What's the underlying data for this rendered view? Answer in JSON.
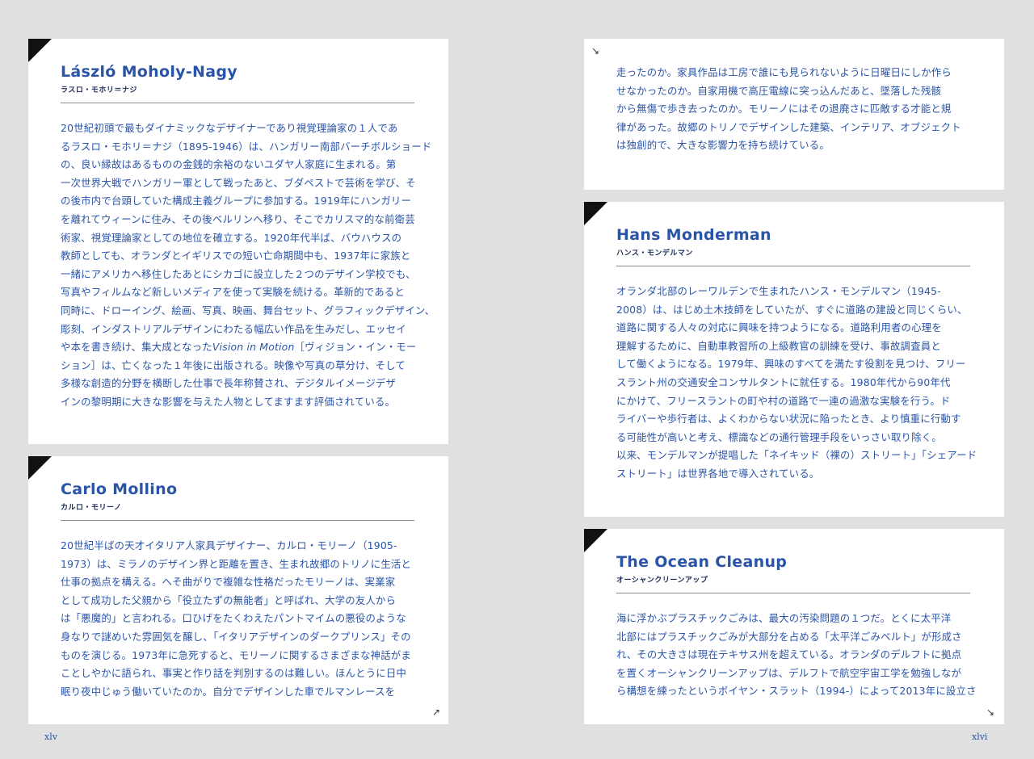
{
  "left_page": {
    "folio": "xlv",
    "entries": [
      {
        "title": "László Moholy-Nagy",
        "kana": "ラスロ・モホリ＝ナジ",
        "lines": [
          "20世紀初頭で最もダイナミックなデザイナーであり視覚理論家の１人であ",
          "るラスロ・モホリ＝ナジ（1895-1946）は、ハンガリー南部バーチボルショード",
          "の、良い縁故はあるものの金銭的余裕のないユダヤ人家庭に生まれる。第",
          "一次世界大戦でハンガリー軍として戦ったあと、ブダペストで芸術を学び、そ",
          "の後市内で台頭していた構成主義グループに参加する。1919年にハンガリー",
          "を離れてウィーンに住み、その後ベルリンへ移り、そこでカリスマ的な前衛芸",
          "術家、視覚理論家としての地位を確立する。1920年代半ば、バウハウスの",
          "教師としても、オランダとイギリスでの短い亡命期間中も、1937年に家族と",
          "一緒にアメリカへ移住したあとにシカゴに設立した２つのデザイン学校でも、",
          "写真やフィルムなど新しいメディアを使って実験を続ける。革新的であると",
          "同時に、ドローイング、絵画、写真、映画、舞台セット、グラフィックデザイン、",
          "彫刻、インダストリアルデザインにわたる幅広い作品を生みだし、エッセイ",
          "や本を書き続け、集大成となったVision in Motion［ヴィジョン・イン・モー",
          "ション］は、亡くなった１年後に出版される。映像や写真の草分け、そして",
          "多様な創造的分野を横断した仕事で長年称賛され、デジタルイメージデザ",
          "インの黎明期に大きな影響を与えた人物としてますます評価されている。"
        ]
      },
      {
        "title": "Carlo Mollino",
        "kana": "カルロ・モリーノ",
        "lines": [
          "20世紀半ばの天才イタリア人家具デザイナー、カルロ・モリーノ（1905-",
          "1973）は、ミラノのデザイン界と距離を置き、生まれ故郷のトリノに生活と",
          "仕事の拠点を構える。へそ曲がりで複雑な性格だったモリーノは、実業家",
          "として成功した父親から「役立たずの無能者」と呼ばれ、大学の友人から",
          "は「悪魔的」と言われる。口ひげをたくわえたパントマイムの悪役のような",
          "身なりで謎めいた雰囲気を醸し、「イタリアデザインのダークプリンス」その",
          "ものを演じる。1973年に急死すると、モリーノに関するさまざまな神話がま",
          "ことしやかに語られ、事実と作り話を判別するのは難しい。ほんとうに日中",
          "眠り夜中じゅう働いていたのか。自分でデザインした車でルマンレースを"
        ]
      }
    ]
  },
  "right_page": {
    "folio": "xlvi",
    "continuation_lines": [
      "走ったのか。家具作品は工房で誰にも見られないように日曜日にしか作ら",
      "せなかったのか。自家用機で高圧電線に突っ込んだあと、墜落した残骸",
      "から無傷で歩き去ったのか。モリーノにはその退廃さに匹敵する才能と規",
      "律があった。故郷のトリノでデザインした建築、インテリア、オブジェクト",
      "は独創的で、大きな影響力を持ち続けている。"
    ],
    "entries": [
      {
        "title": "Hans Monderman",
        "kana": "ハンス・モンデルマン",
        "lines": [
          "オランダ北部のレーワルデンで生まれたハンス・モンデルマン（1945-",
          "2008）は、はじめ土木技師をしていたが、すぐに道路の建設と同じくらい、",
          "道路に関する人々の対応に興味を持つようになる。道路利用者の心理を",
          "理解するために、自動車教習所の上級教官の訓練を受け、事故調査員と",
          "して働くようになる。1979年、興味のすべてを満たす役割を見つけ、フリー",
          "スラント州の交通安全コンサルタントに就任する。1980年代から90年代",
          "にかけて、フリースラントの町や村の道路で一連の過激な実験を行う。ド",
          "ライバーや歩行者は、よくわからない状況に陥ったとき、より慎重に行動す",
          "る可能性が高いと考え、標識などの通行管理手段をいっさい取り除く。",
          "以来、モンデルマンが提唱した「ネイキッド（裸の）ストリート」「シェアード",
          "ストリート」は世界各地で導入されている。"
        ]
      },
      {
        "title": "The Ocean Cleanup",
        "kana": "オーシャンクリーンアップ",
        "lines": [
          "海に浮かぶプラスチックごみは、最大の汚染問題の１つだ。とくに太平洋",
          "北部にはプラスチックごみが大部分を占める「太平洋ごみベルト」が形成さ",
          "れ、その大きさは現在テキサス州を超えている。オランダのデルフトに拠点",
          "を置くオーシャンクリーンアップは、デルフトで航空宇宙工学を勉強しなが",
          "ら構想を練ったというボイヤン・スラット（1994-）によって2013年に設立さ"
        ]
      }
    ]
  },
  "icons": {
    "continue_arrow": "↗",
    "continued_arrow": "↘",
    "end_arrow": "↘"
  }
}
